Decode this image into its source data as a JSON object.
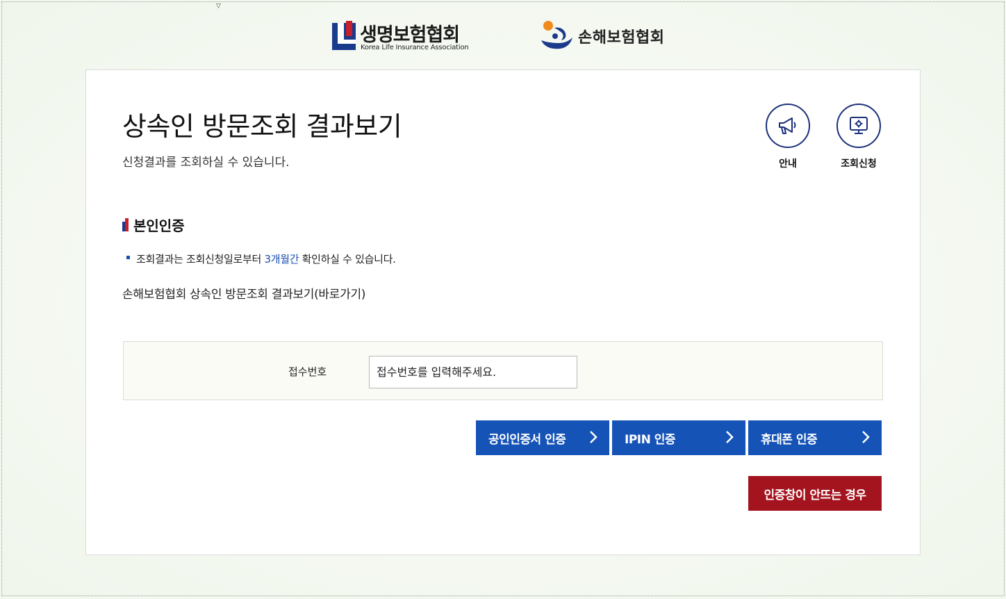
{
  "header": {
    "life_logo_name": "생명보험협회",
    "life_logo_english": "Korea Life Insurance Association",
    "nonlife_logo_name": "손해보험협회"
  },
  "page": {
    "title": "상속인 방문조회 결과보기",
    "subtitle": "신청결과를 조회하실 수 있습니다."
  },
  "quick_menu": {
    "guide_label": "안내",
    "apply_label": "조회신청"
  },
  "section": {
    "title": "본인인증",
    "notice_before": "조회결과는 조회신청일로부터 ",
    "notice_highlight": "3개월간",
    "notice_after": " 확인하실 수 있습니다.",
    "link_text": "손해보험협회 상속인 방문조회 결과보기(바로가기)"
  },
  "form": {
    "label": "접수번호",
    "placeholder": "접수번호를 입력해주세요.",
    "value": ""
  },
  "buttons": {
    "cert": "공인인증서 인증",
    "ipin": "IPIN 인증",
    "phone": "휴대폰 인증",
    "help": "인증창이 안뜨는 경우"
  },
  "colors": {
    "primary_blue": "#1553b7",
    "navy": "#1a2f7a",
    "help_red": "#a3141f",
    "highlight": "#1a4fb0"
  },
  "icons": {
    "guide": "megaphone-icon",
    "apply": "monitor-gear-icon",
    "button_arrow": "chevron-right-icon"
  }
}
